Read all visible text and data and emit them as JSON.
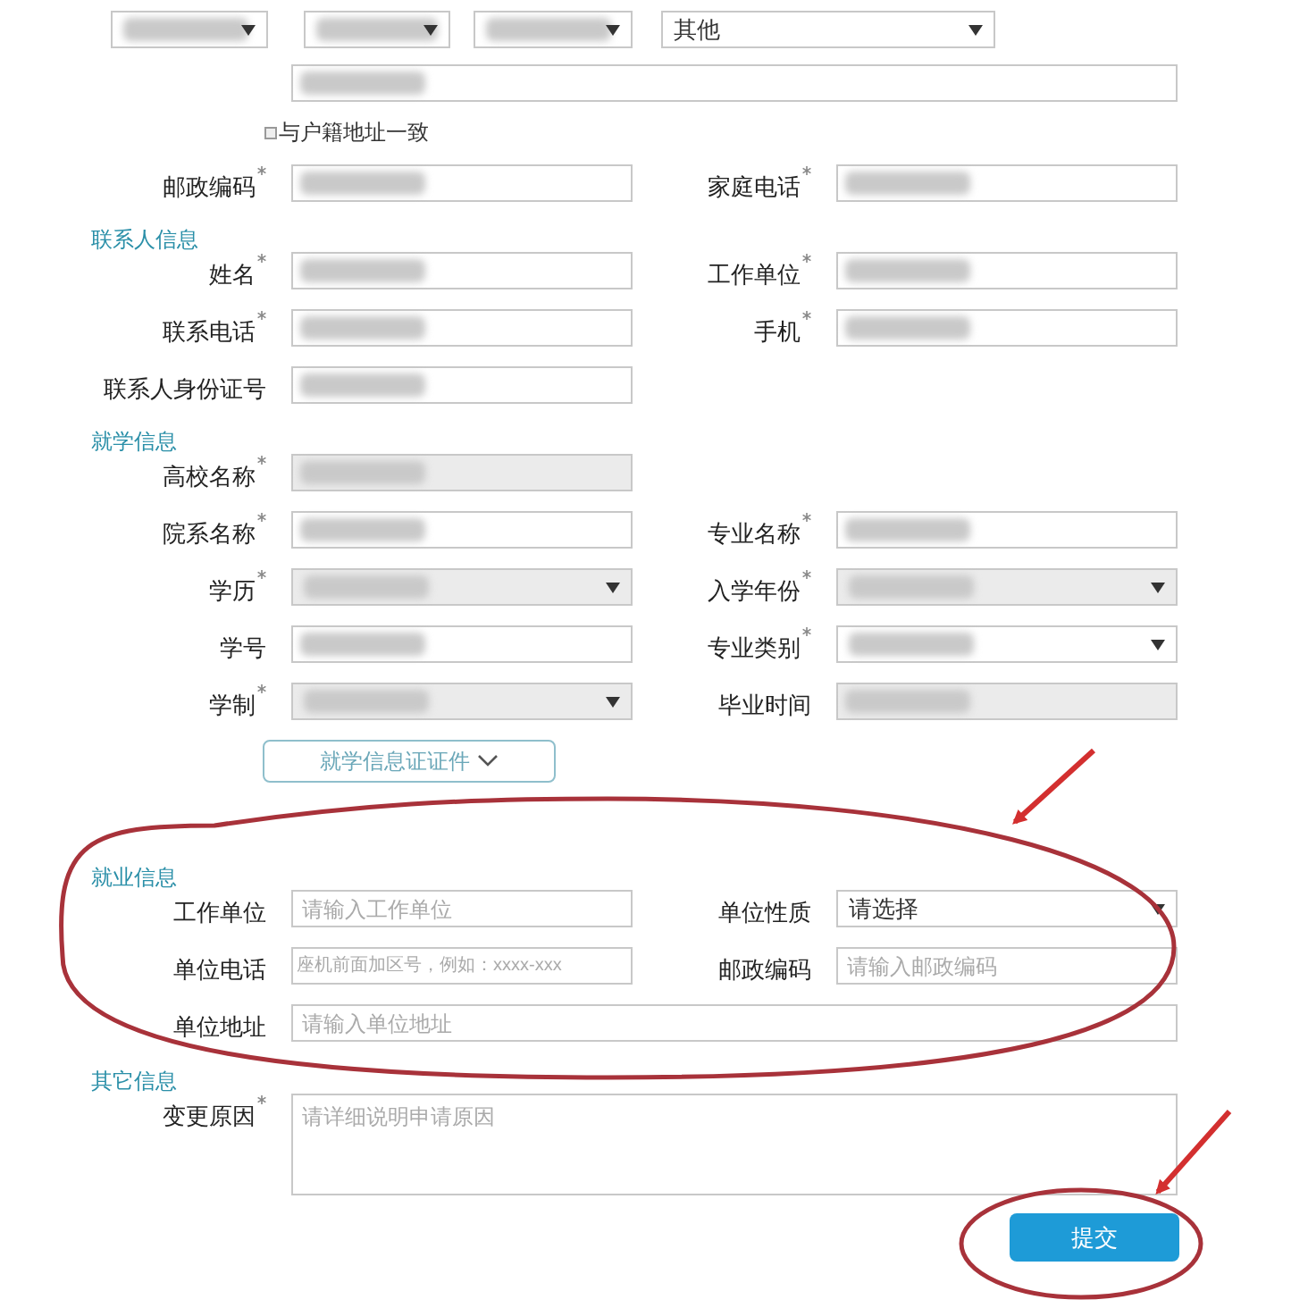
{
  "form": {
    "rows": [
      {
        "kind": "selects",
        "fields": [
          {
            "kind": "select",
            "redacted": true
          },
          {
            "kind": "select",
            "redacted": true
          },
          {
            "kind": "select",
            "redacted": true
          },
          {
            "kind": "select",
            "value": "其他",
            "redacted": false
          }
        ]
      },
      {
        "kind": "full",
        "fields": [
          {
            "kind": "text",
            "redacted": true
          }
        ]
      },
      {
        "kind": "checkbox",
        "label": "与户籍地址一致",
        "checked": false
      },
      {
        "kind": "pair",
        "fields": [
          {
            "label": "邮政编码",
            "required": true,
            "kind": "text",
            "redacted": true
          },
          {
            "label": "家庭电话",
            "required": true,
            "kind": "text",
            "redacted": true
          }
        ]
      },
      {
        "kind": "section",
        "title": "联系人信息"
      },
      {
        "kind": "pair",
        "fields": [
          {
            "label": "姓名",
            "required": true,
            "kind": "text",
            "redacted": true
          },
          {
            "label": "工作单位",
            "required": true,
            "kind": "text",
            "redacted": true
          }
        ]
      },
      {
        "kind": "pair",
        "fields": [
          {
            "label": "联系电话",
            "required": true,
            "kind": "text",
            "redacted": true
          },
          {
            "label": "手机",
            "required": true,
            "kind": "text",
            "redacted": true
          }
        ]
      },
      {
        "kind": "pair",
        "fields": [
          {
            "label": "联系人身份证号",
            "required": false,
            "kind": "text",
            "redacted": true
          }
        ]
      },
      {
        "kind": "section",
        "title": "就学信息"
      },
      {
        "kind": "pair",
        "fields": [
          {
            "label": "高校名称",
            "required": true,
            "kind": "text",
            "redacted": true,
            "disabled": true
          }
        ]
      },
      {
        "kind": "pair",
        "fields": [
          {
            "label": "院系名称",
            "required": true,
            "kind": "text",
            "redacted": true
          },
          {
            "label": "专业名称",
            "required": true,
            "kind": "text",
            "redacted": true
          }
        ]
      },
      {
        "kind": "pair",
        "fields": [
          {
            "label": "学历",
            "required": true,
            "kind": "select",
            "redacted": true,
            "disabled": true
          },
          {
            "label": "入学年份",
            "required": true,
            "kind": "select",
            "redacted": true,
            "disabled": true
          }
        ]
      },
      {
        "kind": "pair",
        "fields": [
          {
            "label": "学号",
            "required": false,
            "kind": "text",
            "redacted": true
          },
          {
            "label": "专业类别",
            "required": true,
            "kind": "select",
            "redacted": true
          }
        ]
      },
      {
        "kind": "pair",
        "fields": [
          {
            "label": "学制",
            "required": true,
            "kind": "select",
            "redacted": true,
            "disabled": true
          },
          {
            "label": "毕业时间",
            "required": false,
            "kind": "text",
            "redacted": true,
            "disabled": true
          }
        ]
      },
      {
        "kind": "expand-button",
        "label": "就学信息证证件",
        "expanded": false
      },
      {
        "kind": "section",
        "title": "就业信息"
      },
      {
        "kind": "pair",
        "fields": [
          {
            "label": "工作单位",
            "required": false,
            "kind": "text",
            "placeholder": "请输入工作单位"
          },
          {
            "label": "单位性质",
            "required": false,
            "kind": "select",
            "value": "请选择"
          }
        ]
      },
      {
        "kind": "pair",
        "fields": [
          {
            "label": "单位电话",
            "required": false,
            "kind": "text",
            "placeholder": "座机前面加区号，例如：xxxx-xxx"
          },
          {
            "label": "邮政编码",
            "required": false,
            "kind": "text",
            "placeholder": "请输入邮政编码"
          }
        ]
      },
      {
        "kind": "full",
        "fields": [
          {
            "label": "单位地址",
            "required": false,
            "kind": "text",
            "placeholder": "请输入单位地址"
          }
        ]
      },
      {
        "kind": "section",
        "title": "其它信息"
      },
      {
        "kind": "full",
        "fields": [
          {
            "label": "变更原因",
            "required": true,
            "kind": "textarea",
            "placeholder": "请详细说明申请原因"
          }
        ]
      },
      {
        "kind": "submit",
        "label": "提交"
      }
    ]
  }
}
